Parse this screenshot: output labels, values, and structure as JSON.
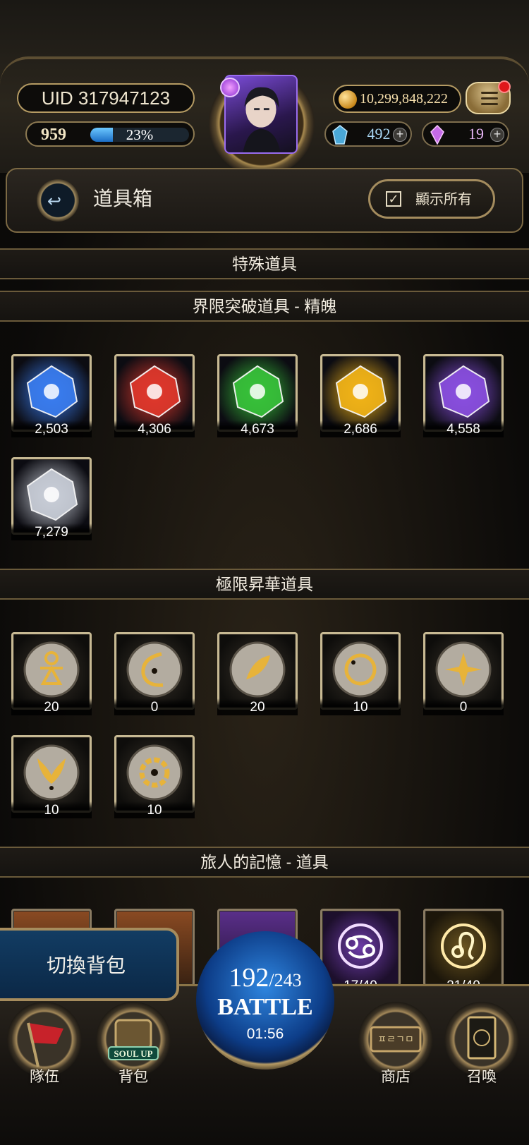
{
  "header": {
    "uid": "UID 317947123",
    "level": "959",
    "exp_percent_text": "23%",
    "exp_fraction": 0.23,
    "gold": "10,299,848,222",
    "blue_gems": "492",
    "purple_gems": "19",
    "plus": "+"
  },
  "title_bar": {
    "title": "道具箱",
    "show_all": "顯示所有"
  },
  "sections": {
    "special": "特殊道具",
    "essence": "界限突破道具 - 精魄",
    "sublimation": "極限昇華道具",
    "travel": "旅人的記憶 - 道具"
  },
  "essence_items": [
    {
      "count": "2,503",
      "color": "#3a7df0"
    },
    {
      "count": "4,306",
      "color": "#e0382c"
    },
    {
      "count": "4,673",
      "color": "#38c23a"
    },
    {
      "count": "2,686",
      "color": "#f2b418"
    },
    {
      "count": "4,558",
      "color": "#8a4fe0"
    },
    {
      "count": "7,279",
      "color": "#c9ced8"
    }
  ],
  "sublimation_items": [
    {
      "count": "20",
      "glyph": "ankh-sigil-icon"
    },
    {
      "count": "0",
      "glyph": "crescent-sigil-icon"
    },
    {
      "count": "20",
      "glyph": "leaf-sigil-icon"
    },
    {
      "count": "10",
      "glyph": "ring-sigil-icon"
    },
    {
      "count": "0",
      "glyph": "star-sigil-icon"
    },
    {
      "count": "10",
      "glyph": "wing-sigil-icon"
    },
    {
      "count": "10",
      "glyph": "gear-sigil-icon"
    }
  ],
  "travel_items": [
    {
      "count": "17/40"
    },
    {
      "count": "21/40"
    }
  ],
  "switch_bag": "切換背包",
  "battle": {
    "stamina": "192",
    "stamina_max": "/243",
    "label": "BATTLE",
    "timer": "01:56"
  },
  "nav": {
    "team": "隊伍",
    "bag": "背包",
    "bag_badge": "SOUL UP",
    "shop": "商店",
    "shop_sign": "ㅍㄹㄱㅁ",
    "summon": "召喚"
  }
}
